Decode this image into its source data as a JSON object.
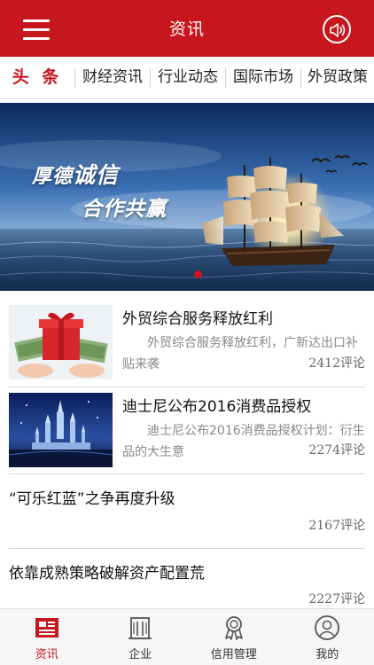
{
  "header": {
    "title": "资讯",
    "menu_icon": "hamburger-menu-icon",
    "speaker_icon": "speaker-icon",
    "brand_color": "#c8161e"
  },
  "tabs": [
    {
      "label": "头 条",
      "active": true
    },
    {
      "label": "财经资讯",
      "active": false
    },
    {
      "label": "行业动态",
      "active": false
    },
    {
      "label": "国际市场",
      "active": false
    },
    {
      "label": "外贸政策",
      "active": false
    }
  ],
  "banner": {
    "slogan_line1_part1": "厚德",
    "slogan_line1_part2": "诚信",
    "slogan_line2": "合作共赢",
    "active_slide": 1
  },
  "news": [
    {
      "title": "外贸综合服务释放红利",
      "summary": "外贸综合服务释放红利，广新达出口补贴来袭",
      "comments": "2412评论",
      "thumbnail": "gift-box-money-image"
    },
    {
      "title": "迪士尼公布2016消费品授权",
      "summary": "迪士尼公布2016消费品授权计划：衍生品的大生意",
      "comments": "2274评论",
      "thumbnail": "castle-night-image"
    },
    {
      "title": "“可乐红蓝”之争再度升级",
      "comments": "2167评论"
    },
    {
      "title": "依靠成熟策略破解资产配置荒",
      "comments": "2227评论"
    }
  ],
  "bottom_nav": [
    {
      "label": "资讯",
      "icon": "news-icon",
      "active": true
    },
    {
      "label": "企业",
      "icon": "building-icon",
      "active": false
    },
    {
      "label": "信用管理",
      "icon": "award-ribbon-icon",
      "active": false
    },
    {
      "label": "我的",
      "icon": "user-profile-icon",
      "active": false
    }
  ]
}
